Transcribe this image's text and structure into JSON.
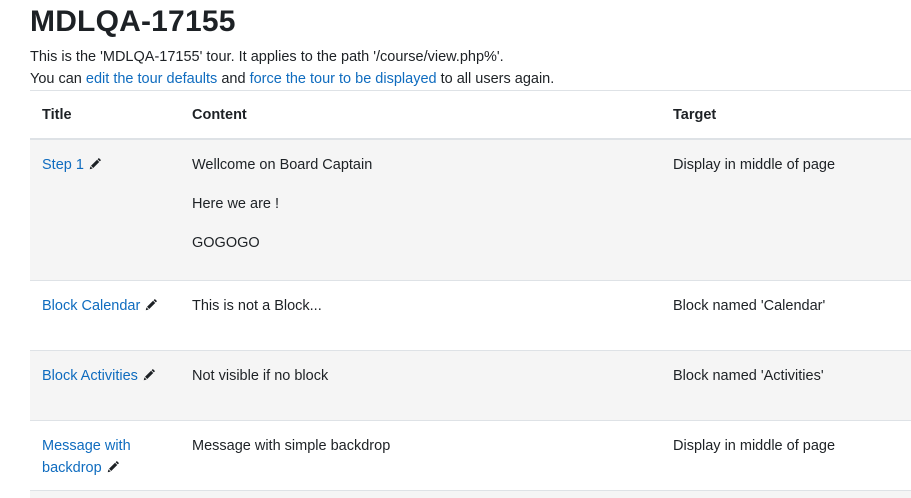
{
  "page": {
    "title": "MDLQA-17155",
    "intro_line1": "This is the 'MDLQA-17155' tour. It applies to the path '/course/view.php%'.",
    "intro_line2_prefix": "You can ",
    "edit_defaults_link": "edit the tour defaults",
    "intro_line2_middle": " and ",
    "force_display_link": "force the tour to be displayed",
    "intro_line2_suffix": " to all users again."
  },
  "table": {
    "headers": {
      "title": "Title",
      "content": "Content",
      "target": "Target"
    },
    "rows": [
      {
        "title": "Step 1",
        "content": [
          "Wellcome on Board Captain",
          "Here we are !",
          "GOGOGO"
        ],
        "target": "Display in middle of page"
      },
      {
        "title": "Block Calendar",
        "content": [
          "This is not a Block..."
        ],
        "target": "Block named 'Calendar'"
      },
      {
        "title": "Block Activities",
        "content": [
          "Not visible if no block"
        ],
        "target": "Block named 'Activities'"
      },
      {
        "title_line1": "Message with",
        "title_line2": "backdrop",
        "content": [
          "Message with simple backdrop"
        ],
        "target": "Display in middle of page"
      }
    ],
    "edit_icon": "pencil-icon"
  }
}
